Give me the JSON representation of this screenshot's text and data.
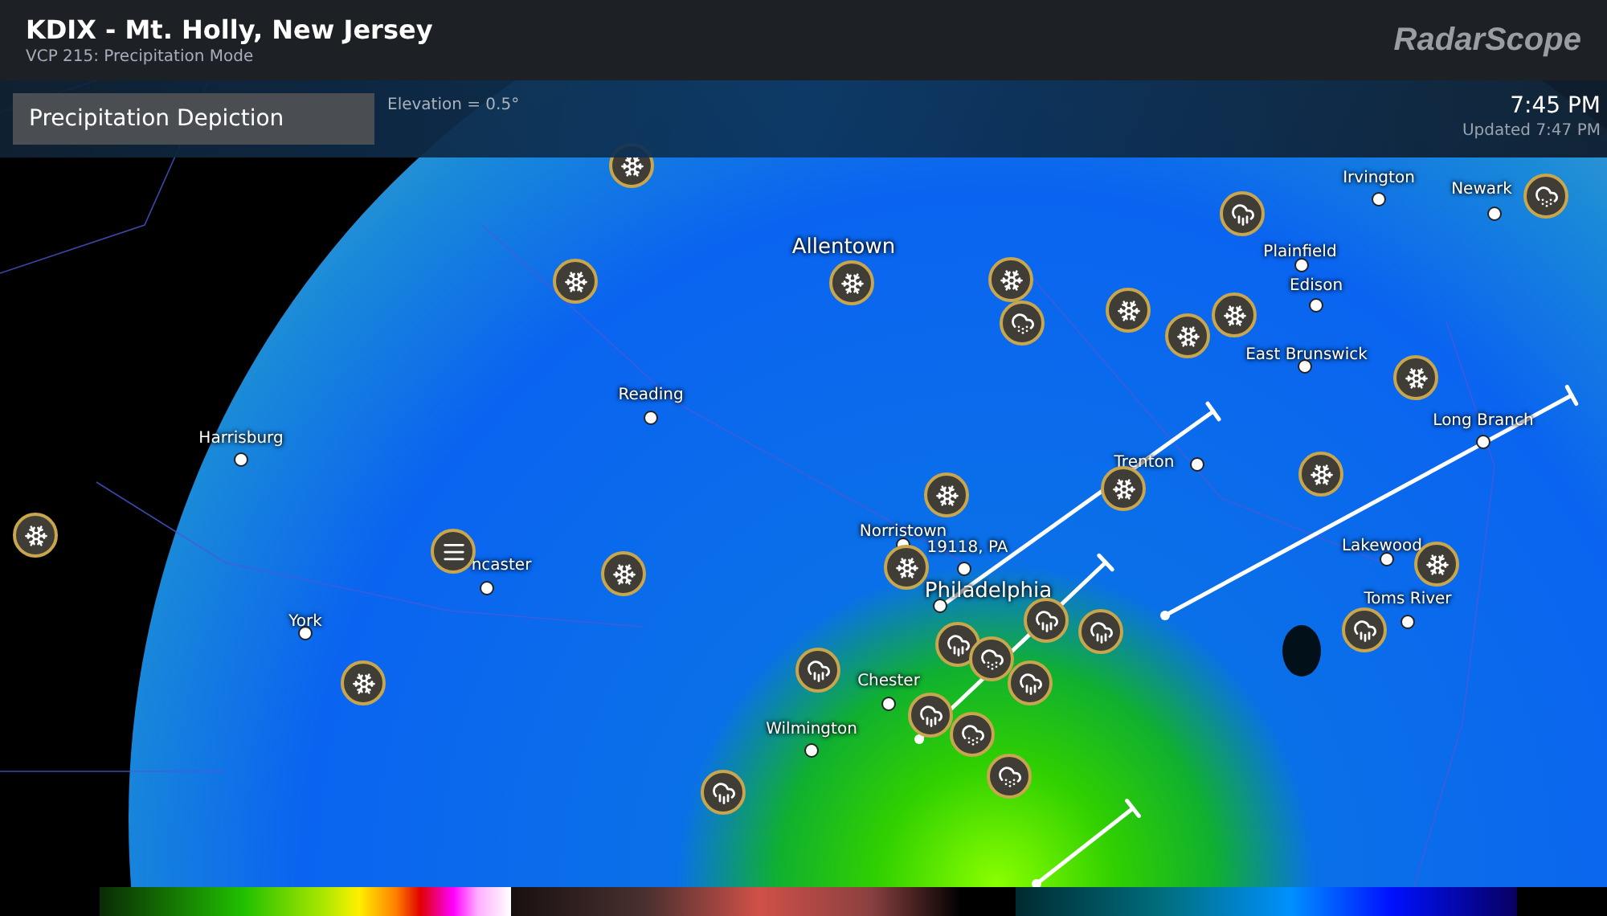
{
  "header": {
    "title": "KDIX - Mt. Holly, New Jersey",
    "subtitle": "VCP 215: Precipitation Mode",
    "logo": "RadarScope"
  },
  "product_bar": {
    "product": "Precipitation Depiction",
    "elevation": "Elevation = 0.5°",
    "time": "7:45 PM",
    "updated": "Updated 7:47 PM"
  },
  "cities": [
    {
      "name": "Irvington"
    },
    {
      "name": "Newark"
    },
    {
      "name": "Allentown"
    },
    {
      "name": "Plainfield"
    },
    {
      "name": "Edison"
    },
    {
      "name": "East Brunswick"
    },
    {
      "name": "Reading"
    },
    {
      "name": "Harrisburg"
    },
    {
      "name": "Long Branch"
    },
    {
      "name": "Trenton"
    },
    {
      "name": "Norristown"
    },
    {
      "name": "19118, PA"
    },
    {
      "name": "Lakewood"
    },
    {
      "name": "ncaster"
    },
    {
      "name": "Philadelphia"
    },
    {
      "name": "Toms River"
    },
    {
      "name": "York"
    },
    {
      "name": "Chester"
    },
    {
      "name": "Wilmington"
    }
  ],
  "markers": [
    {
      "kind": "snow"
    },
    {
      "kind": "snow"
    },
    {
      "kind": "snow"
    },
    {
      "kind": "snow"
    },
    {
      "kind": "snow"
    },
    {
      "kind": "snow"
    },
    {
      "kind": "snow"
    },
    {
      "kind": "snow"
    },
    {
      "kind": "snow"
    },
    {
      "kind": "snow"
    },
    {
      "kind": "snow"
    },
    {
      "kind": "snow"
    },
    {
      "kind": "snow"
    },
    {
      "kind": "snow"
    },
    {
      "kind": "snow"
    },
    {
      "kind": "snow"
    },
    {
      "kind": "rain"
    },
    {
      "kind": "rain"
    },
    {
      "kind": "rain"
    },
    {
      "kind": "rain"
    },
    {
      "kind": "rain"
    },
    {
      "kind": "rain"
    },
    {
      "kind": "rain"
    },
    {
      "kind": "rain"
    },
    {
      "kind": "rain"
    },
    {
      "kind": "mix"
    },
    {
      "kind": "mix"
    },
    {
      "kind": "mix"
    },
    {
      "kind": "mix"
    },
    {
      "kind": "mix"
    },
    {
      "kind": "haze"
    }
  ]
}
